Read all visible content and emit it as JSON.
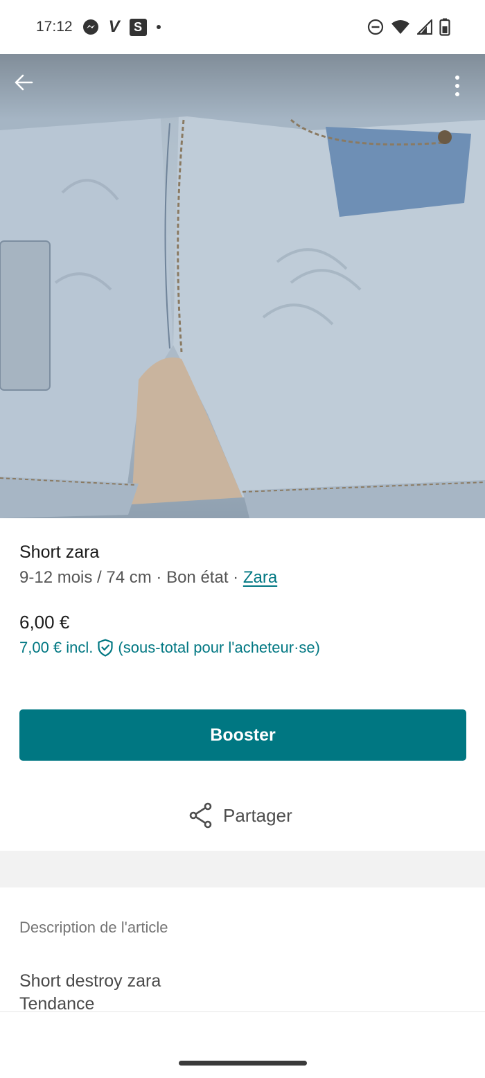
{
  "status_bar": {
    "time": "17:12",
    "icons": [
      "messenger-icon",
      "v-app-icon",
      "s-app-icon",
      "dot-icon",
      "dnd-icon",
      "wifi-icon",
      "signal-icon",
      "battery-icon"
    ],
    "v_glyph": "V",
    "s_glyph": "S"
  },
  "item": {
    "title": "Short zara",
    "size": "9-12 mois / 74 cm",
    "condition": "Bon état",
    "brand": "Zara",
    "price": "6,00 €",
    "price_incl": "7,00 € incl.",
    "price_incl_suffix": "(sous-total pour l'acheteur·se)"
  },
  "actions": {
    "booster_label": "Booster",
    "share_label": "Partager"
  },
  "description": {
    "heading": "Description de l'article",
    "line1": "Short destroy zara",
    "line2": "Tendance"
  },
  "colors": {
    "accent": "#007782",
    "divider": "#f2f2f2"
  },
  "separator": "·"
}
